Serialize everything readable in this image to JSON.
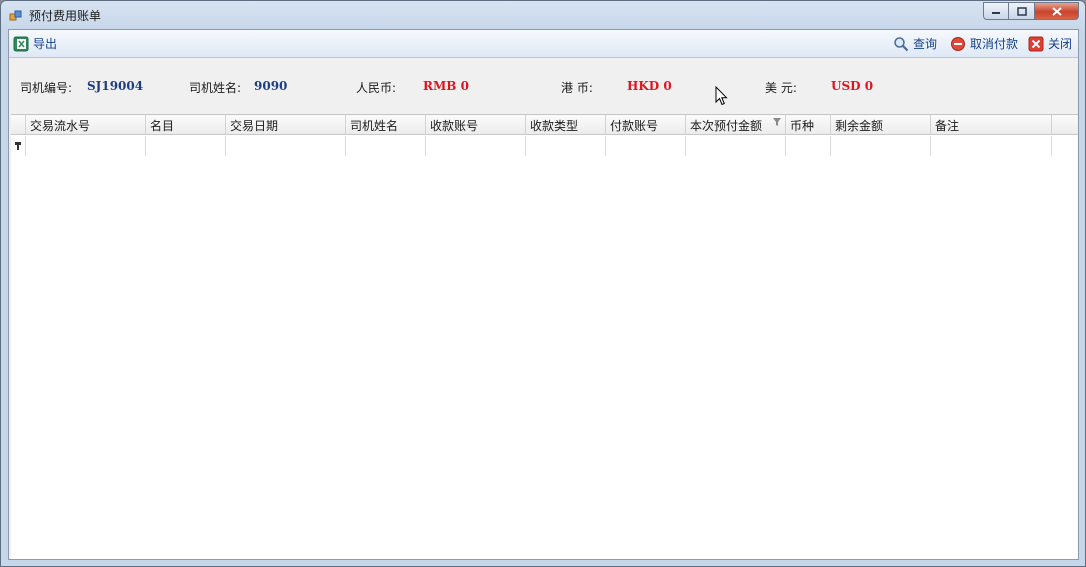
{
  "window": {
    "title": "预付费用账单"
  },
  "toolbar": {
    "export_label": "导出",
    "query_label": "查询",
    "cancel_payment_label": "取消付款",
    "close_label": "关闭"
  },
  "info": {
    "driver_id_label": "司机编号:",
    "driver_id_value": "SJ19004",
    "driver_name_label": "司机姓名:",
    "driver_name_value": "9090",
    "rmb_label": "人民币:",
    "rmb_value": "RMB 0",
    "hkd_label": "港 币:",
    "hkd_value": "HKD 0",
    "usd_label": "美 元:",
    "usd_value": "USD 0"
  },
  "grid": {
    "columns": [
      "交易流水号",
      "名目",
      "交易日期",
      "司机姓名",
      "收款账号",
      "收款类型",
      "付款账号",
      "本次预付金额",
      "币种",
      "剩余金额",
      "备注"
    ],
    "rows": []
  },
  "colors": {
    "accent_blue": "#1f3e82",
    "amount_red": "#e0141c",
    "toolbar_text": "#15428b"
  }
}
